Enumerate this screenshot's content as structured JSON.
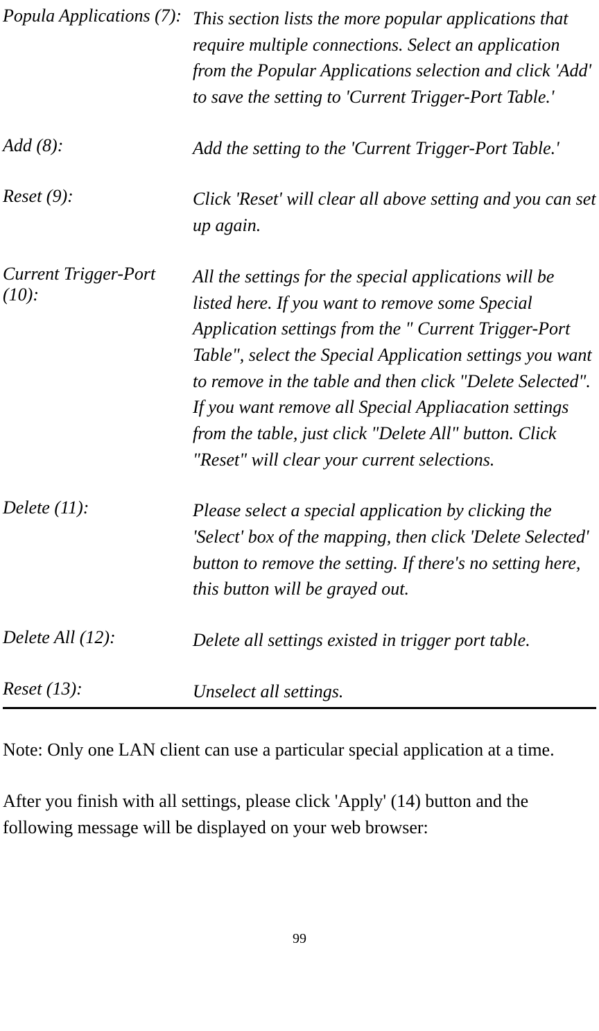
{
  "definitions": [
    {
      "term": "Popula Applications (7):",
      "desc": "This section lists the more popular applications that require multiple connections. Select an application from the Popular Applications selection and click 'Add' to save the setting to 'Current Trigger-Port Table.'"
    },
    {
      "term": "Add (8):",
      "desc": "Add the setting to the 'Current Trigger-Port Table.'"
    },
    {
      "term": "Reset (9):",
      "desc": "Click 'Reset' will clear all above setting and you can set up again."
    },
    {
      "term": "Current Trigger-Port (10):",
      "desc": "All the settings for the special applications will be listed here. If you want to remove some Special Application settings from the \" Current Trigger-Port Table\", select the Special Application settings you want to remove in the table and then click \"Delete Selected\". If you want remove all Special Appliacation settings from the table, just click \"Delete All\" button. Click \"Reset\" will clear your current selections."
    },
    {
      "term": "Delete (11):",
      "desc": "Please select a special application by clicking the 'Select' box of the mapping, then click 'Delete Selected' button to remove the setting. If there's no setting here, this button will be grayed out."
    },
    {
      "term": "Delete All (12):",
      "desc": "Delete all settings existed in trigger port table."
    },
    {
      "term": "Reset (13):",
      "desc": "Unselect all settings."
    }
  ],
  "note": "Note: Only one LAN client can use a particular special application at a time.",
  "paragraph": "After you finish with all settings, please click 'Apply' (14) button and the following message will be displayed on your web browser:",
  "pageNumber": "99"
}
